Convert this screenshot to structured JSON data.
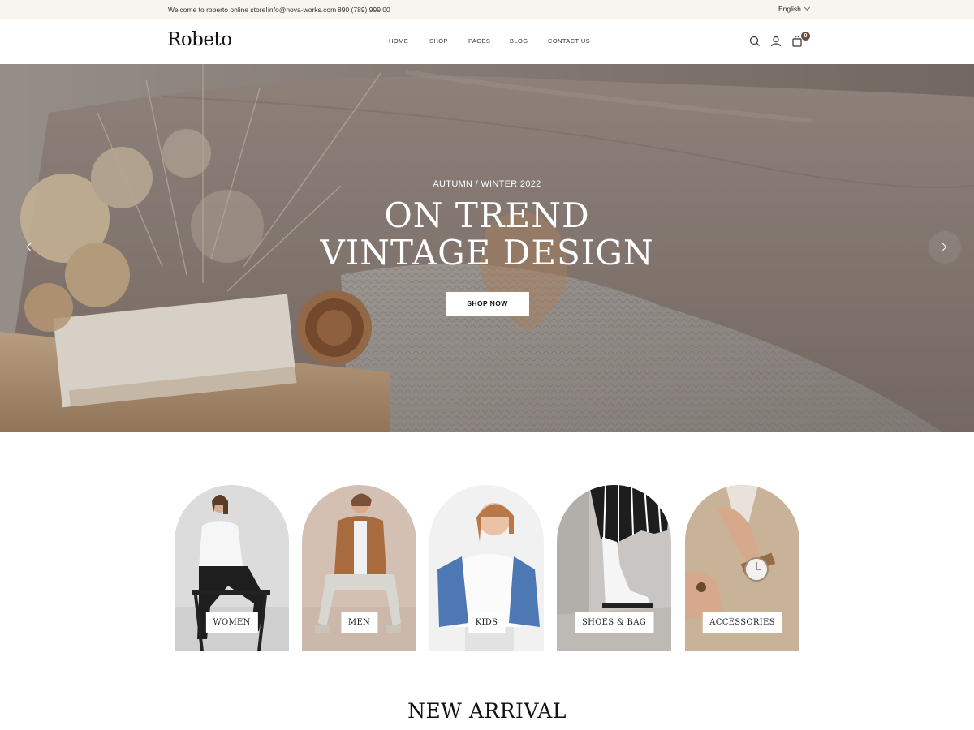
{
  "topbar": {
    "welcome": "Welcome to roberto online store!",
    "email": "info@nova-works.com",
    "phone": "890 (789) 999 00",
    "language": "English"
  },
  "header": {
    "logo": "Robeto",
    "nav": [
      "HOME",
      "SHOP",
      "PAGES",
      "BLOG",
      "CONTACT US"
    ],
    "icons": [
      "search-icon",
      "user-icon",
      "bag-icon"
    ],
    "cart_count": "0"
  },
  "hero": {
    "eyebrow": "AUTUMN / WINTER 2022",
    "title_line1": "ON TREND",
    "title_line2": "VINTAGE DESIGN",
    "cta": "SHOP NOW"
  },
  "categories": [
    {
      "label": "WOMEN"
    },
    {
      "label": "MEN"
    },
    {
      "label": "KIDS"
    },
    {
      "label": "SHOES & BAG"
    },
    {
      "label": "ACCESSORIES"
    }
  ],
  "section_title": "NEW ARRIVAL",
  "colors": {
    "topbar_bg": "#f8f4f0",
    "badge": "#6b4e3d",
    "hero_tone": "#8d7f78"
  }
}
